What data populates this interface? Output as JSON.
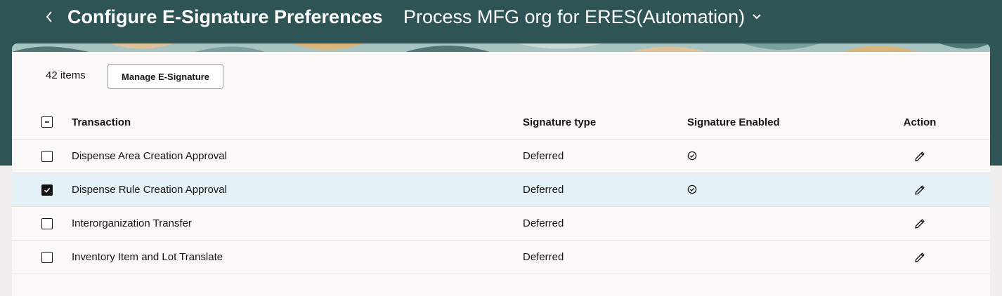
{
  "header": {
    "title": "Configure E-Signature Preferences",
    "org_selector": "Process MFG org for ERES(Automation)"
  },
  "toolbar": {
    "item_count": "42 items",
    "manage_button": "Manage E-Signature"
  },
  "table": {
    "columns": {
      "transaction": "Transaction",
      "signature_type": "Signature type",
      "signature_enabled": "Signature Enabled",
      "action": "Action"
    },
    "rows": [
      {
        "transaction": "Dispense Area Creation Approval",
        "signature_type": "Deferred",
        "signature_enabled": true,
        "selected": false
      },
      {
        "transaction": "Dispense Rule Creation Approval",
        "signature_type": "Deferred",
        "signature_enabled": true,
        "selected": true
      },
      {
        "transaction": "Interorganization Transfer",
        "signature_type": "Deferred",
        "signature_enabled": false,
        "selected": false
      },
      {
        "transaction": "Inventory Item and Lot Translate",
        "signature_type": "Deferred",
        "signature_enabled": false,
        "selected": false
      }
    ]
  },
  "colors": {
    "header_bg": "#2f5456",
    "selected_row_bg": "#e4f1f7",
    "card_bg": "#fbf9f8"
  },
  "icons": {
    "back": "chevron-left-icon",
    "org_dropdown": "chevron-down-icon",
    "enabled": "check-circle-icon",
    "edit": "pencil-icon"
  }
}
